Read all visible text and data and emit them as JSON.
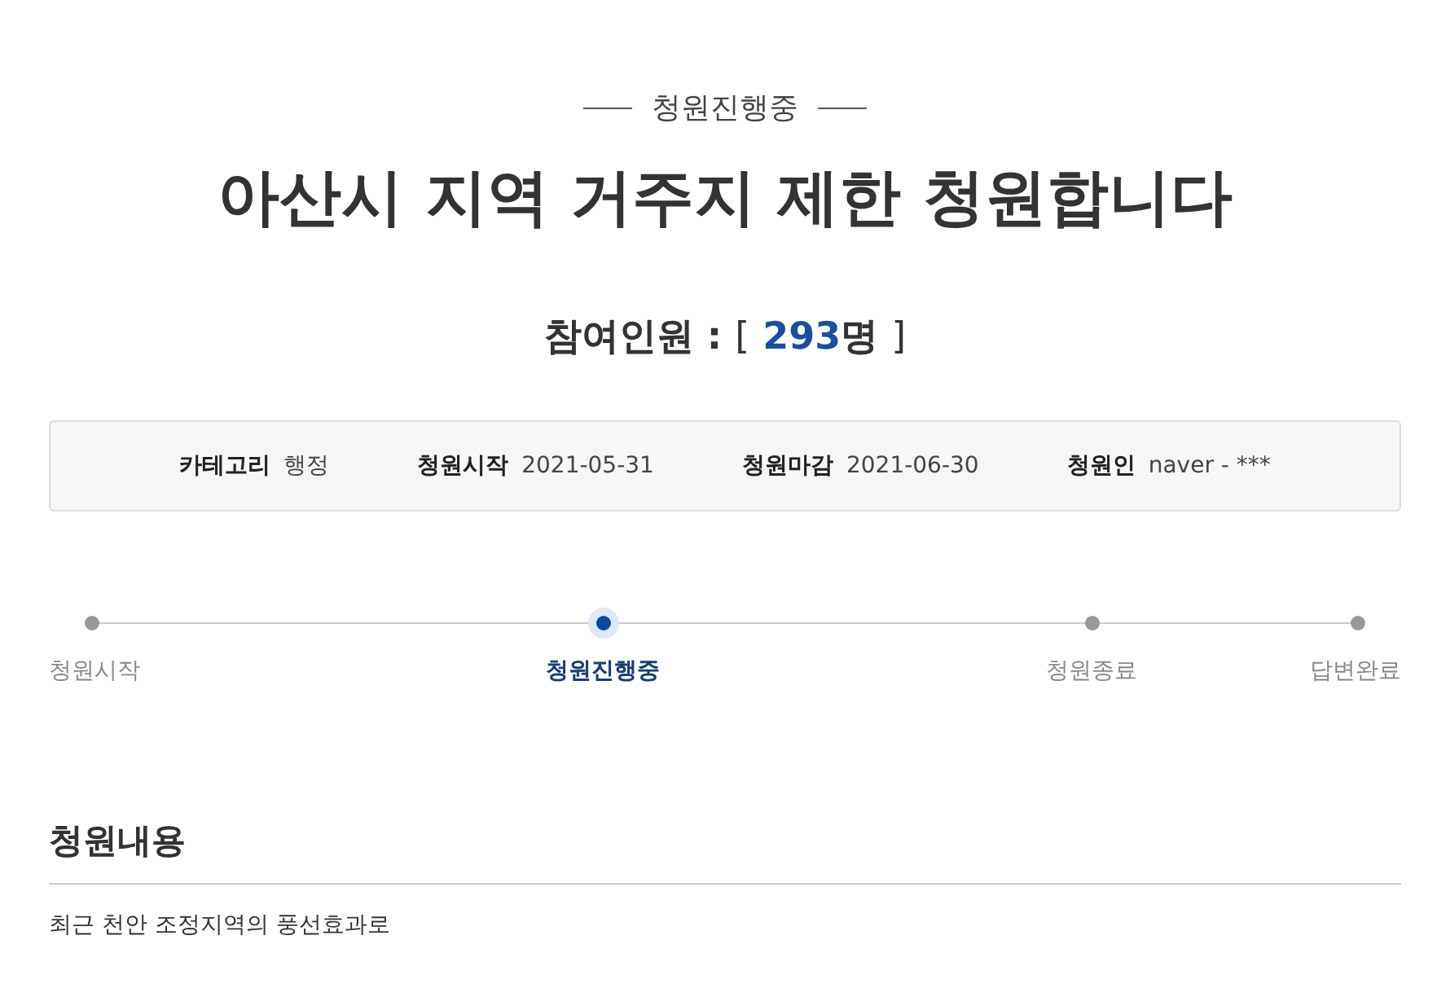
{
  "status": "청원진행중",
  "title": "아산시 지역 거주지 제한 청원합니다",
  "participants": {
    "label": "참여인원 :",
    "open": "[",
    "count": "293",
    "unit": "명",
    "close": "]"
  },
  "info": [
    {
      "label": "카테고리",
      "value": "행정"
    },
    {
      "label": "청원시작",
      "value": "2021-05-31"
    },
    {
      "label": "청원마감",
      "value": "2021-06-30"
    },
    {
      "label": "청원인",
      "value": "naver - ***"
    }
  ],
  "steps": [
    {
      "label": "청원시작",
      "selected": false
    },
    {
      "label": "청원진행중",
      "selected": true
    },
    {
      "label": "청원종료",
      "selected": false
    },
    {
      "label": "답변완료",
      "selected": false
    }
  ],
  "content": {
    "heading": "청원내용",
    "text": "최근 천안 조정지역의 풍선효과로"
  }
}
